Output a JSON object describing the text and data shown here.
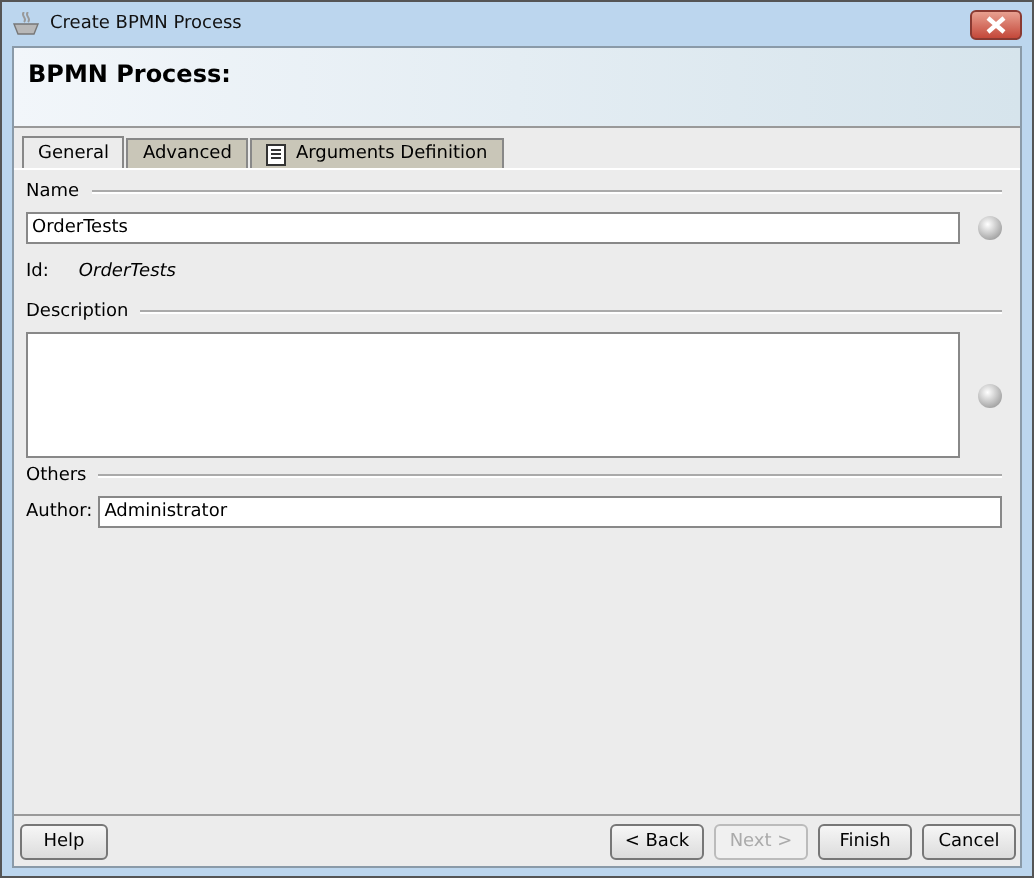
{
  "window": {
    "title": "Create BPMN Process"
  },
  "header": {
    "title": "BPMN Process:"
  },
  "tabs": [
    {
      "label": "General",
      "selected": true,
      "kind": "plain"
    },
    {
      "label": "Advanced",
      "selected": false,
      "kind": "plain"
    },
    {
      "label": "Arguments Definition",
      "selected": false,
      "kind": "document"
    }
  ],
  "name_section": {
    "title": "Name",
    "value": "OrderTests",
    "id_label": "Id:",
    "id_value": "OrderTests"
  },
  "description_section": {
    "title": "Description"
  },
  "others_section": {
    "title": "Others",
    "author_label": "Author:",
    "author_value": "Administrator"
  },
  "buttons": [
    {
      "label": "Help",
      "disabled": false,
      "kind": "left"
    },
    {
      "label": "< Back",
      "disabled": false,
      "kind": "right"
    },
    {
      "label": "Next >",
      "disabled": true,
      "kind": "right"
    },
    {
      "label": "Finish",
      "disabled": false,
      "kind": "right"
    },
    {
      "label": "Cancel",
      "disabled": false,
      "kind": "right"
    }
  ]
}
